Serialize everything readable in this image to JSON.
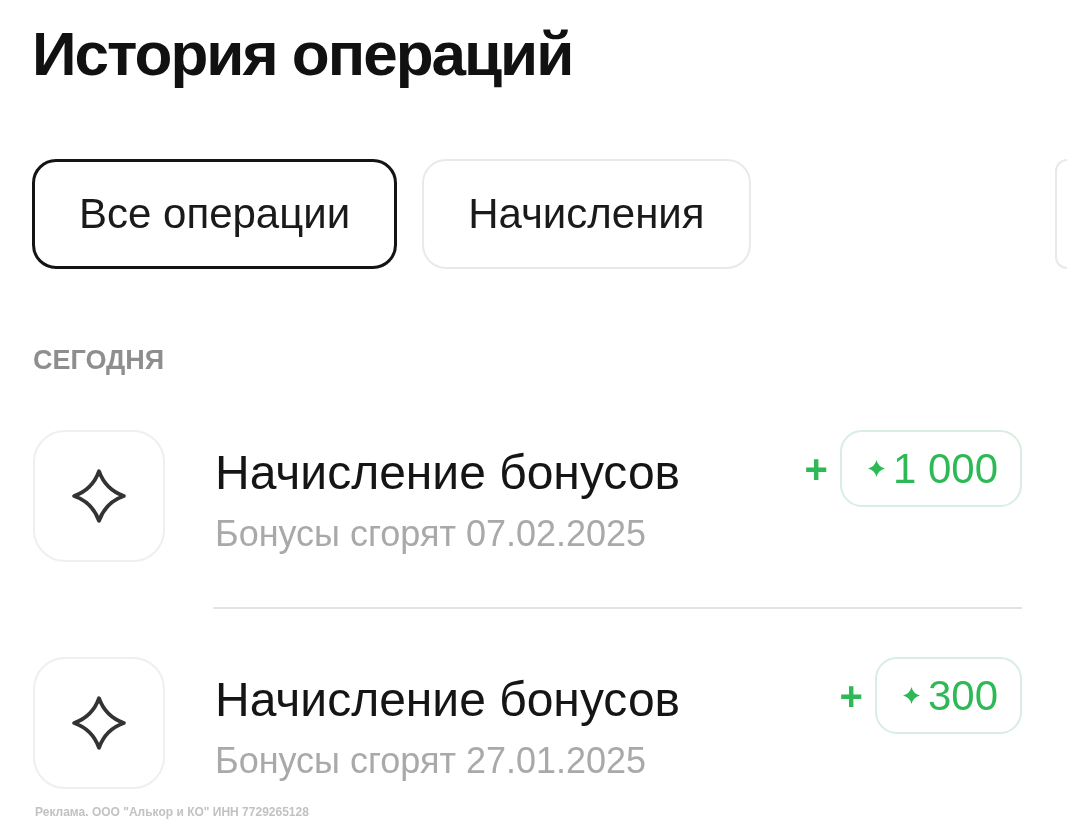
{
  "title": "История операций",
  "tabs": [
    {
      "label": "Все операции",
      "selected": true
    },
    {
      "label": "Начисления",
      "selected": false
    },
    {
      "selected": false
    }
  ],
  "section": {
    "heading": "СЕГОДНЯ",
    "operations": [
      {
        "title": "Начисление бонусов",
        "subtitle": "Бонусы сгорят 07.02.2025",
        "sign": "+",
        "amount": "1 000"
      },
      {
        "title": "Начисление бонусов",
        "subtitle": "Бонусы сгорят 27.01.2025",
        "sign": "+",
        "amount": "300"
      }
    ]
  },
  "ad_disclosure": "Реклама. ООО \"Алькор и КО\" ИНН 7729265128"
}
